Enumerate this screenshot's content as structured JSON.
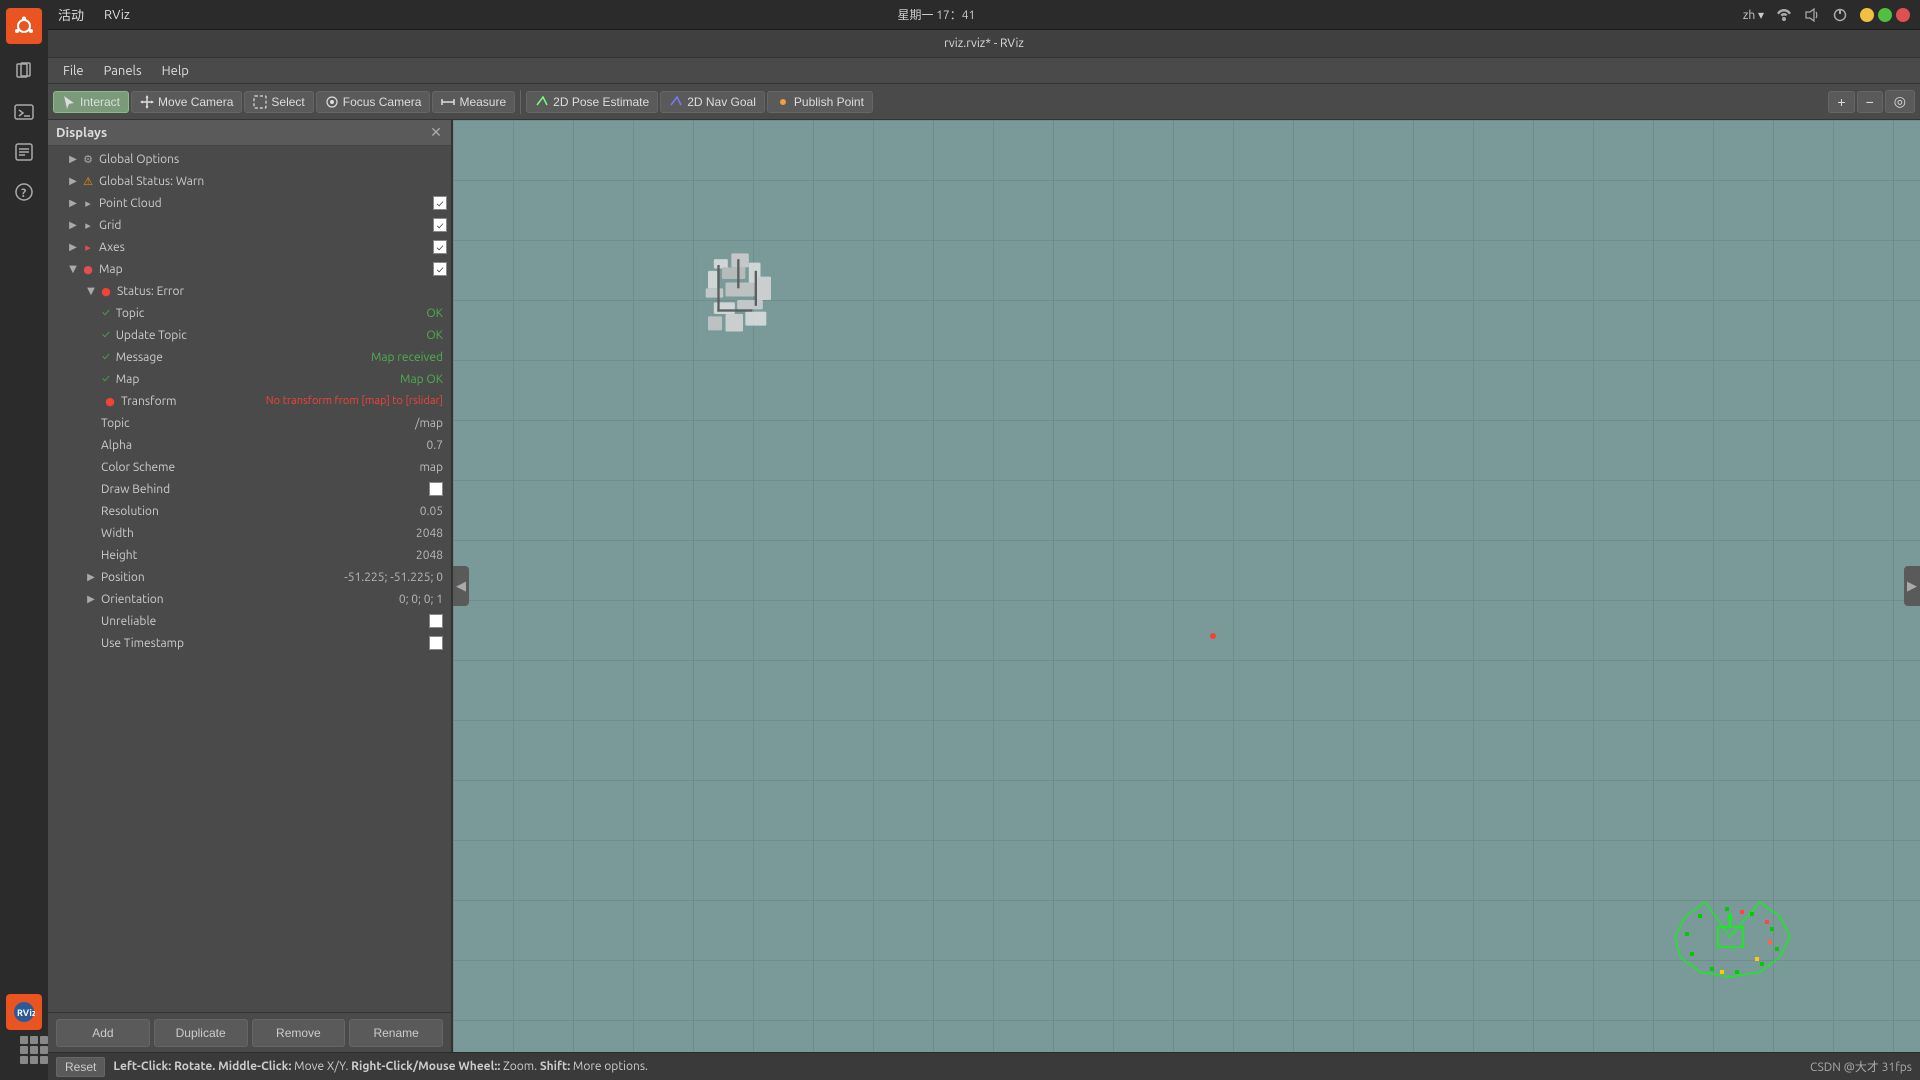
{
  "app": {
    "title": "rviz.rviz* - RViz",
    "datetime": "星期一 17：41",
    "locale": "zh"
  },
  "topbar": {
    "activity_label": "活动",
    "app_name": "RViz",
    "datetime": "星期一 17：41",
    "locale": "zh ▾"
  },
  "menubar": {
    "items": [
      {
        "label": "File"
      },
      {
        "label": "Panels"
      },
      {
        "label": "Help"
      }
    ]
  },
  "toolbar": {
    "buttons": [
      {
        "label": "Interact",
        "active": true,
        "icon": "cursor"
      },
      {
        "label": "Move Camera",
        "active": false,
        "icon": "move"
      },
      {
        "label": "Select",
        "active": false,
        "icon": "select"
      },
      {
        "label": "Focus Camera",
        "active": false,
        "icon": "focus"
      },
      {
        "label": "Measure",
        "active": false,
        "icon": "measure"
      },
      {
        "label": "2D Pose Estimate",
        "active": false,
        "icon": "pose"
      },
      {
        "label": "2D Nav Goal",
        "active": false,
        "icon": "nav"
      },
      {
        "label": "Publish Point",
        "active": false,
        "icon": "point"
      }
    ],
    "view_icons": [
      "+",
      "−",
      "◎"
    ]
  },
  "displays": {
    "header": "Displays",
    "items": [
      {
        "id": "global-options",
        "label": "Global Options",
        "expanded": false,
        "indent": 1,
        "icon": "gear",
        "icon_color": "#aaaaaa"
      },
      {
        "id": "global-status",
        "label": "Global Status: Warn",
        "expanded": false,
        "indent": 1,
        "icon": "warn",
        "icon_color": "#ff9800"
      },
      {
        "id": "point-cloud",
        "label": "Point Cloud",
        "expanded": false,
        "indent": 1,
        "icon": "arrow",
        "icon_color": "#aaaaaa",
        "checked": true
      },
      {
        "id": "grid",
        "label": "Grid",
        "expanded": false,
        "indent": 1,
        "icon": "arrow",
        "icon_color": "#aaaaaa",
        "checked": true
      },
      {
        "id": "axes",
        "label": "Axes",
        "expanded": false,
        "indent": 1,
        "icon": "arrow",
        "icon_color": "#e05050",
        "checked": true
      },
      {
        "id": "map",
        "label": "Map",
        "expanded": true,
        "indent": 1,
        "icon": "circle",
        "icon_color": "#e05050",
        "checked": true
      }
    ],
    "map_children": [
      {
        "id": "status-error",
        "label": "Status: Error",
        "indent": 2,
        "icon": "error",
        "icon_color": "#f44336"
      },
      {
        "id": "topic-ok",
        "label": "Topic",
        "value": "OK",
        "indent": 3,
        "check": true
      },
      {
        "id": "update-topic-ok",
        "label": "Update Topic",
        "value": "OK",
        "indent": 3,
        "check": true
      },
      {
        "id": "message-ok",
        "label": "Message",
        "value": "Map received",
        "indent": 3,
        "check": true
      },
      {
        "id": "map-ok",
        "label": "Map",
        "value": "Map OK",
        "indent": 3,
        "check": true
      },
      {
        "id": "transform-error",
        "label": "Transform",
        "value": "No transform from [map] to [rslidar]",
        "indent": 3,
        "icon": "error",
        "icon_color": "#f44336"
      }
    ],
    "map_properties": [
      {
        "label": "Topic",
        "value": "/map"
      },
      {
        "label": "Alpha",
        "value": "0.7"
      },
      {
        "label": "Color Scheme",
        "value": "map"
      },
      {
        "label": "Draw Behind",
        "value": "",
        "type": "checkbox"
      },
      {
        "label": "Resolution",
        "value": "0.05"
      },
      {
        "label": "Width",
        "value": "2048"
      },
      {
        "label": "Height",
        "value": "2048"
      },
      {
        "label": "Position",
        "value": "-51.225; -51.225; 0",
        "expandable": true
      },
      {
        "label": "Orientation",
        "value": "0; 0; 0; 1",
        "expandable": true
      },
      {
        "label": "Unreliable",
        "value": "",
        "type": "checkbox"
      },
      {
        "label": "Use Timestamp",
        "value": "",
        "type": "checkbox"
      }
    ]
  },
  "panel_buttons": {
    "add": "Add",
    "duplicate": "Duplicate",
    "remove": "Remove",
    "rename": "Rename"
  },
  "statusbar": {
    "reset": "Reset",
    "hint": "Left-Click: Rotate. Middle-Click: Move X/Y. Right-Click/Mouse Wheel:: Zoom. Shift: More options.",
    "fps": "CSDN @大才 31fps"
  }
}
